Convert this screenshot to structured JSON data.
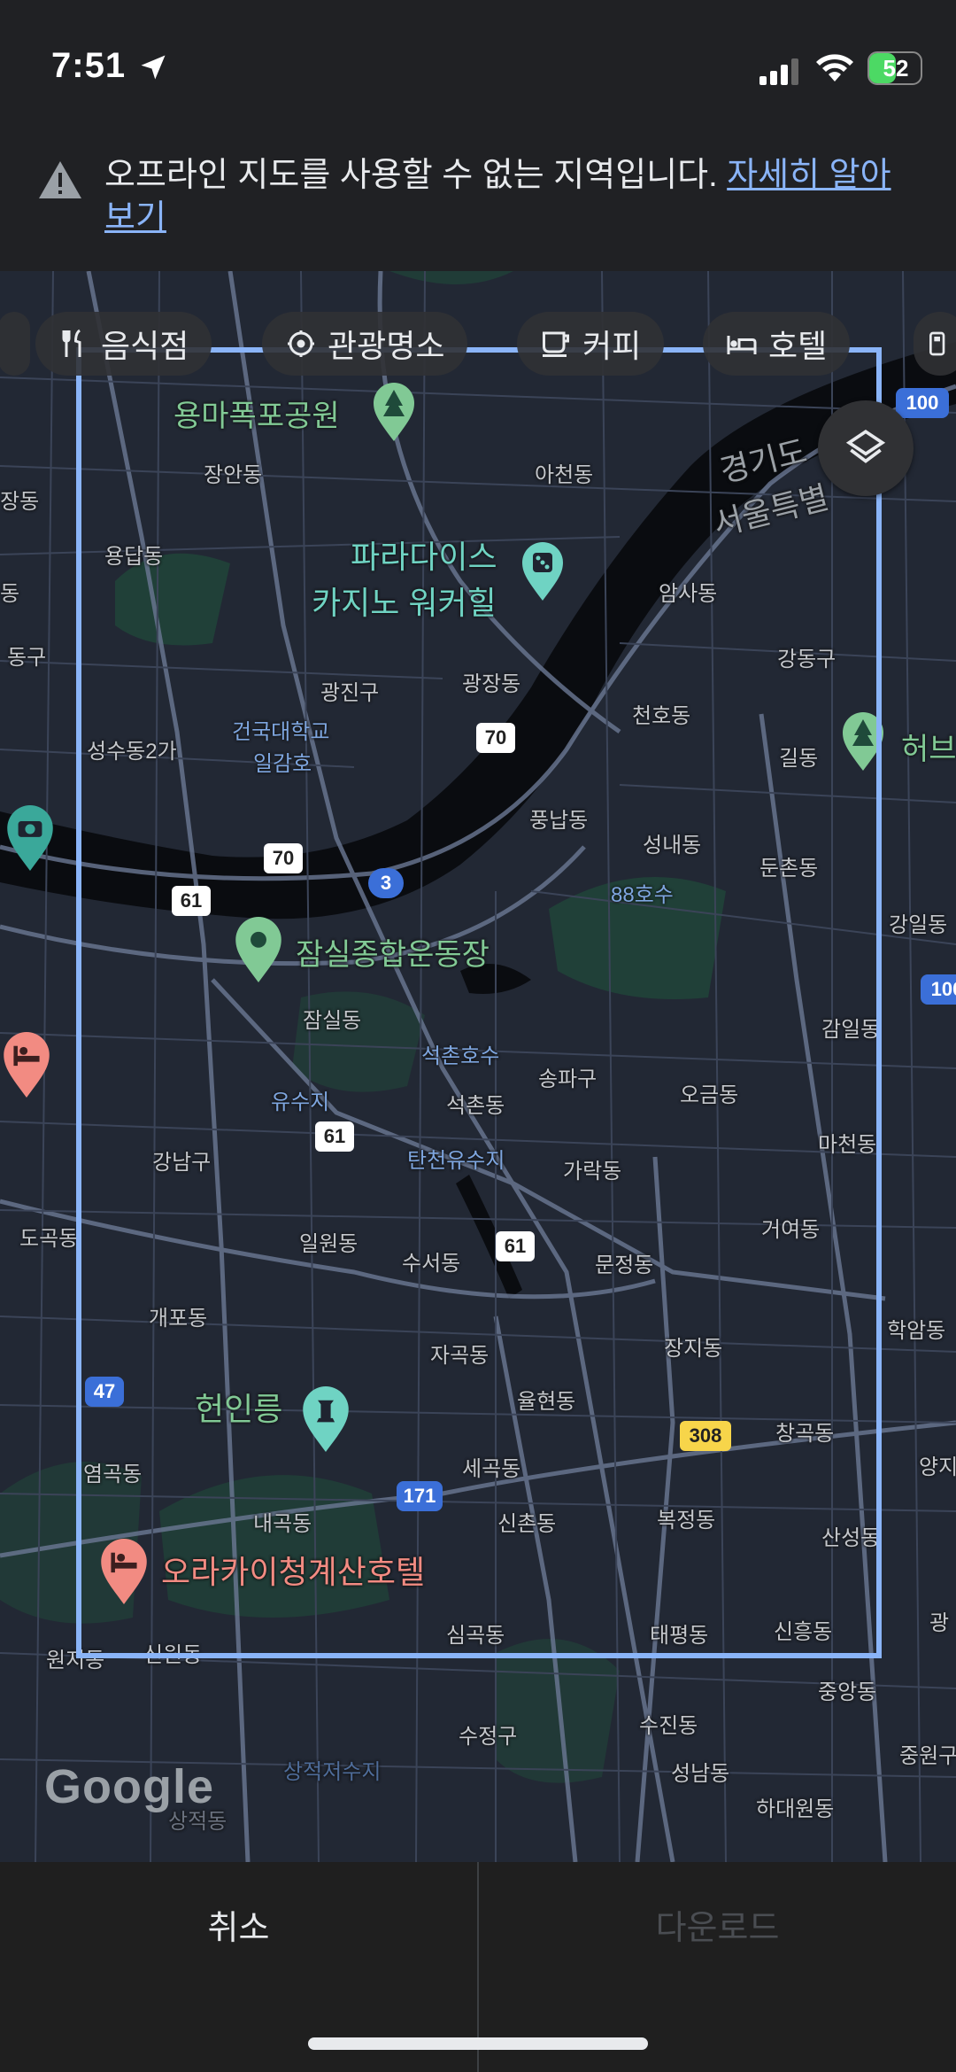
{
  "status_bar": {
    "time": "7:51",
    "battery": "52",
    "battery_level": 0.52
  },
  "banner": {
    "message": "오프라인 지도를 사용할 수 없는 지역입니다. ",
    "link": "자세히 알아보기",
    "icon": "warning-icon"
  },
  "chips": [
    {
      "label": "음식점",
      "icon": "restaurant-icon"
    },
    {
      "label": "관광명소",
      "icon": "attraction-icon"
    },
    {
      "label": "커피",
      "icon": "coffee-icon"
    },
    {
      "label": "호텔",
      "icon": "hotel-icon"
    }
  ],
  "map": {
    "places": {
      "yongma": "용마폭포공원",
      "jangan": "장안동",
      "achen": "아천동",
      "gyeonggi": "경기도",
      "seoul": "서울특별",
      "yongdap": "용답동",
      "paradise1": "파라다이스",
      "paradise2": "카지노 워커힐",
      "amsa": "암사동",
      "gangdong": "강동구",
      "gwangjin": "광진구",
      "gwangjang": "광장동",
      "cheonho": "천호동",
      "seongsu": "성수동2가",
      "konkuk1": "건국대학교",
      "konkuk2": "일감호",
      "gil": "길동",
      "hub": "허브",
      "pungnap": "풍납동",
      "seongnae": "성내동",
      "dunchon": "둔촌동",
      "lake88": "88호수",
      "jamsil_stadium": "잠실종합운동장",
      "jamsil": "잠실동",
      "seokchon_lake": "석촌호수",
      "songpa": "송파구",
      "yusuji": "유수지",
      "seokchon": "석촌동",
      "ogeum": "오금동",
      "gangnam": "강남구",
      "tancheon": "탄천유수지",
      "garak": "가락동",
      "macheon": "마천동",
      "ilwon": "일원동",
      "suseo": "수서동",
      "munjeong": "문정동",
      "geoyeo": "거여동",
      "gaepo": "개포동",
      "jagok": "자곡동",
      "jangji": "장지동",
      "heoninneung": "헌인릉",
      "yulhyeon": "율현동",
      "changgok": "창곡동",
      "yeomgok": "염곡동",
      "segok": "세곡동",
      "naegok": "내곡동",
      "sinchon": "신촌동",
      "bokjeong": "복정동",
      "sanseong": "산성동",
      "okura": "오라카이청계산호텔",
      "simgok": "심곡동",
      "taepyeong": "태평동",
      "sinheung": "신흥동",
      "sinwon": "신원동",
      "jungang": "중앙동",
      "sujeong_gu": "수정구",
      "sujin": "수진동",
      "jungwon": "중원구",
      "seongnam": "성남동",
      "hadaewon": "하대원동",
      "sangjeok1": "상적저수지",
      "sangjeok2": "상적동",
      "gangil": "강일동",
      "gamil": "감일동",
      "hakam": "학암동",
      "yangji": "양지",
      "gwangnam": "광",
      "dogok": "도곡동",
      "wonji": "원지동",
      "jangan_left": "장동",
      "seongdong_left": "동구",
      "left_mid": "동"
    },
    "routes": [
      "70",
      "70",
      "61",
      "61",
      "61",
      "3",
      "47",
      "171",
      "308",
      "100",
      "100"
    ],
    "logo": "Google"
  },
  "bottom": {
    "cancel": "취소",
    "download": "다운로드"
  }
}
